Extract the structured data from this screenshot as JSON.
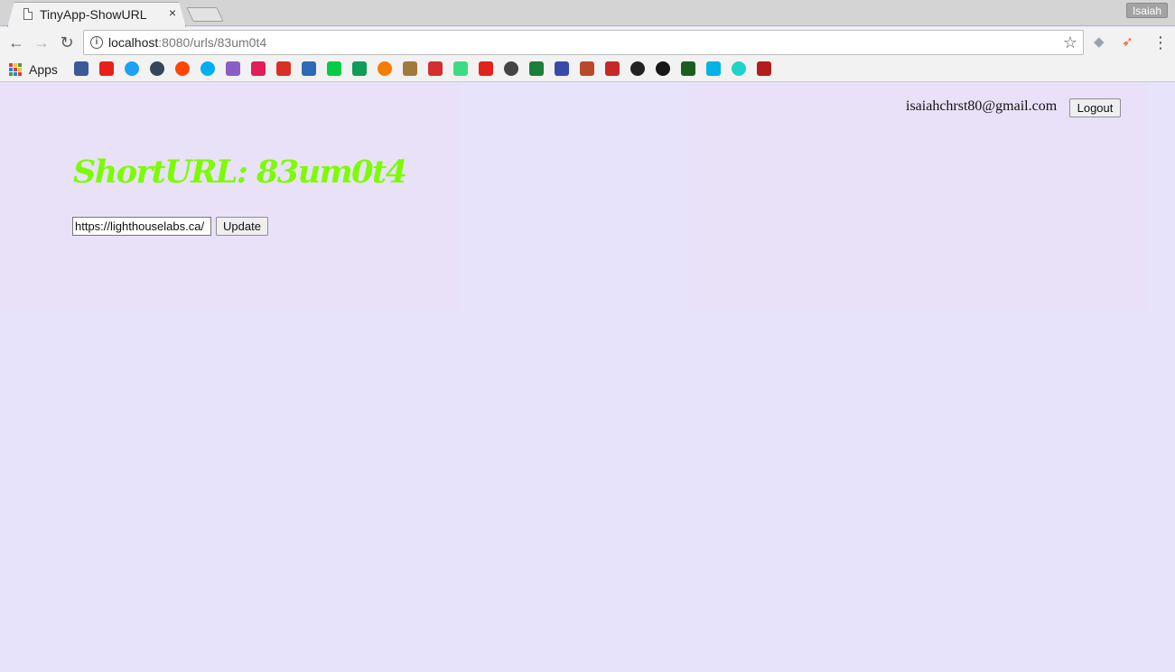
{
  "browser": {
    "tab": {
      "title": "TinyApp-ShowURL",
      "close_glyph": "×"
    },
    "profile_name": "Isaiah",
    "address": {
      "host": "localhost",
      "path": ":8080/urls/83um0t4"
    },
    "nav": {
      "back_glyph": "←",
      "forward_glyph": "→",
      "reload_glyph": "↻",
      "star_glyph": "☆",
      "menu_glyph": "⋮"
    },
    "bookmarks": {
      "apps_label": "Apps",
      "apps_grid_colors": [
        "#e53935",
        "#fbc02d",
        "#43a047",
        "#1e88e5",
        "#e53935",
        "#fbc02d",
        "#43a047",
        "#1e88e5",
        "#e53935"
      ],
      "items": [
        {
          "icon": "facebook-icon",
          "color": "#3b5998"
        },
        {
          "icon": "youtube-icon",
          "color": "#e62117"
        },
        {
          "icon": "twitter-icon",
          "color": "#1da1f2"
        },
        {
          "icon": "tumblr-icon",
          "color": "#35465c"
        },
        {
          "icon": "reddit-icon",
          "color": "#ff4500"
        },
        {
          "icon": "skype-icon",
          "color": "#00aff0"
        },
        {
          "icon": "messenger-icon",
          "color": "#8a5fc5"
        },
        {
          "icon": "slack-icon",
          "color": "#e01e5a"
        },
        {
          "icon": "gmail-icon",
          "color": "#d93025"
        },
        {
          "icon": "pandora-icon",
          "color": "#2d6cb4"
        },
        {
          "icon": "deviantart-icon",
          "color": "#05cc47"
        },
        {
          "icon": "app-icon-green",
          "color": "#0f9d58"
        },
        {
          "icon": "dragonball-icon",
          "color": "#f57c00"
        },
        {
          "icon": "runner-icon",
          "color": "#a07a3a"
        },
        {
          "icon": "mario-icon",
          "color": "#d32f2f"
        },
        {
          "icon": "android-icon",
          "color": "#3ddc84"
        },
        {
          "icon": "roblox-icon",
          "color": "#e2231a"
        },
        {
          "icon": "egg-icon",
          "color": "#444444"
        },
        {
          "icon": "cat-icon",
          "color": "#1b7f3b"
        },
        {
          "icon": "book-icon",
          "color": "#3949ab"
        },
        {
          "icon": "calendar-icon",
          "color": "#b84a2b"
        },
        {
          "icon": "kanji-icon",
          "color": "#c62828"
        },
        {
          "icon": "plus-circle-icon",
          "color": "#222222"
        },
        {
          "icon": "github-icon",
          "color": "#181717"
        },
        {
          "icon": "terminal-icon",
          "color": "#1b5e20"
        },
        {
          "icon": "udacity-icon",
          "color": "#02b3e4"
        },
        {
          "icon": "codecademy-icon",
          "color": "#1fd3c8"
        },
        {
          "icon": "pixel-icon",
          "color": "#b71c1c"
        }
      ]
    }
  },
  "page": {
    "user_email": "isaiahchrst80@gmail.com",
    "logout_label": "Logout",
    "title": "ShortURL: 83um0t4",
    "long_url_value": "https://lighthouselabs.ca/",
    "update_label": "Update",
    "colors": {
      "title": "#7cfc00",
      "background": "#e6e6fa"
    }
  }
}
